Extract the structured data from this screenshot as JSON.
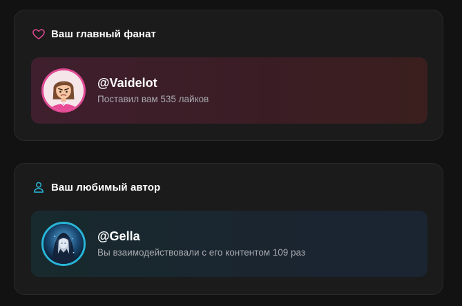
{
  "top_fan": {
    "title": "Ваш главный фанат",
    "username": "@Vaidelot",
    "description": "Поставил вам 535 лайков",
    "accent_color": "#e04a93",
    "icon": "heart-icon"
  },
  "favorite_author": {
    "title": "Ваш любимый автор",
    "username": "@Gella",
    "description": "Вы взаимодействовали с его контентом 109 раз",
    "accent_color": "#29b6d8",
    "icon": "user-icon"
  }
}
